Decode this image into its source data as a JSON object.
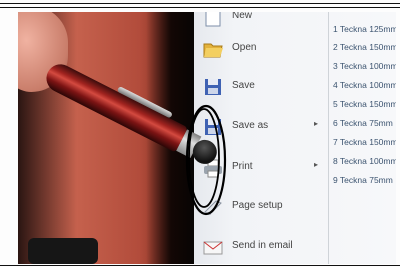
{
  "menu": {
    "items": [
      {
        "label": "New",
        "icon": "new-document-icon"
      },
      {
        "label": "Open",
        "icon": "folder-open-icon"
      },
      {
        "label": "Save",
        "icon": "floppy-disk-icon"
      },
      {
        "label": "Save as",
        "icon": "floppy-disk-icon"
      },
      {
        "label": "Print",
        "icon": "printer-icon"
      },
      {
        "label": "Page setup",
        "icon": "page-setup-icon"
      },
      {
        "label": "Send in email",
        "icon": "email-icon"
      }
    ],
    "submenu_arrow": "▸"
  },
  "recent_files": [
    "1  Teckna 125mm",
    "2  Teckna 150mm",
    "3  Teckna 100mm",
    "4  Teckna 100mm",
    "5  Teckna 150mm",
    "6  Teckna 75mm",
    "7  Teckna 150mm",
    "8  Teckna 100mm",
    "9  Teckna 75mm"
  ],
  "colors": {
    "annotation_ring": "#000000",
    "menu_text": "#444444",
    "recent_text": "#3c5470"
  }
}
